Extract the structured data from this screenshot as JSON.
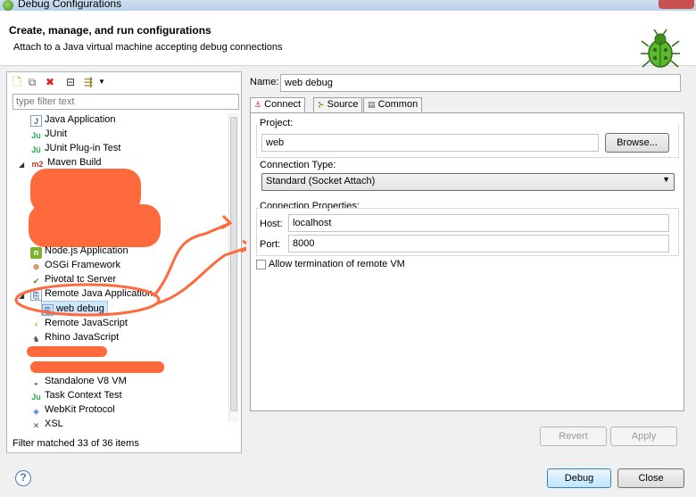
{
  "window": {
    "title": "Debug Configurations"
  },
  "header": {
    "title": "Create, manage, and run configurations",
    "description": "Attach to a Java virtual machine accepting debug connections",
    "icon": "bug-icon"
  },
  "left": {
    "filter_placeholder": "type filter text",
    "tree": [
      {
        "label": "Java Application",
        "icon": "java-app-icon"
      },
      {
        "label": "JUnit",
        "icon": "junit-icon"
      },
      {
        "label": "JUnit Plug-in Test",
        "icon": "junit-plugin-icon"
      },
      {
        "label": "Maven Build",
        "icon": "maven-icon"
      },
      {
        "label": "Node.js Application",
        "icon": "nodejs-icon"
      },
      {
        "label": "OSGi Framework",
        "icon": "osgi-icon"
      },
      {
        "label": "Pivotal tc Server",
        "icon": "pivotal-icon"
      },
      {
        "label": "Remote Java Application",
        "icon": "remote-java-icon"
      },
      {
        "label": "web debug",
        "icon": "debug-config-icon"
      },
      {
        "label": "Remote JavaScript",
        "icon": "remote-js-icon"
      },
      {
        "label": "Rhino JavaScript",
        "icon": "rhino-icon"
      },
      {
        "label": "Standalone V8 VM",
        "icon": "v8-icon"
      },
      {
        "label": "Task Context Test",
        "icon": "task-context-icon"
      },
      {
        "label": "WebKit Protocol",
        "icon": "webkit-icon"
      },
      {
        "label": "XSL",
        "icon": "xsl-icon"
      }
    ],
    "filter_status": "Filter matched 33 of 36 items"
  },
  "right": {
    "name_label": "Name:",
    "name_value": "web debug",
    "tabs": [
      {
        "label": "Connect"
      },
      {
        "label": "Source"
      },
      {
        "label": "Common"
      }
    ],
    "project_label": "Project:",
    "project_value": "web",
    "browse_label": "Browse...",
    "connection_type_label": "Connection Type:",
    "connection_type_value": "Standard (Socket Attach)",
    "connection_props_label": "Connection Properties:",
    "host_label": "Host:",
    "host_value": "localhost",
    "port_label": "Port:",
    "port_value": "8000",
    "allow_termination_label": "Allow termination of remote VM",
    "revert_label": "Revert",
    "apply_label": "Apply"
  },
  "footer": {
    "debug_label": "Debug",
    "close_label": "Close"
  },
  "colors": {
    "annotation": "#ff6a3d",
    "selection": "#cde8ff"
  }
}
